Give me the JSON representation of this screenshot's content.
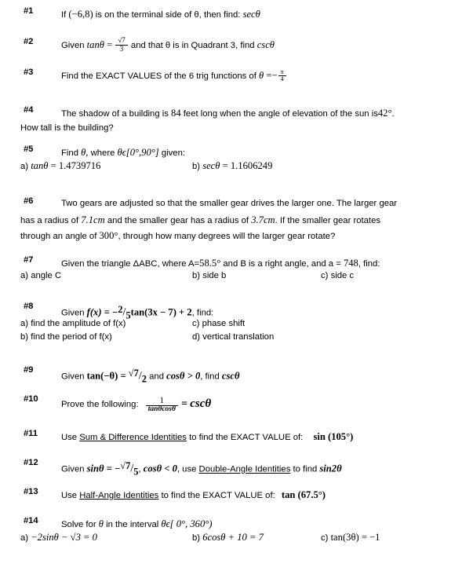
{
  "document": {
    "type": "trigonometry-worksheet",
    "background_color": "#ffffff",
    "text_color": "#000000"
  },
  "problems": [
    {
      "number": "#1",
      "lead": "If",
      "point": "(−6,8)",
      "mid": "is on the terminal side of θ, then find:",
      "answer_fn": "secθ"
    },
    {
      "number": "#2",
      "lead": "Given",
      "fn": "tanθ",
      "eq": "=",
      "frac_num": "√7",
      "frac_den": "3",
      "mid": "and that θ is in Quadrant 3, find",
      "answer_fn": "cscθ"
    },
    {
      "number": "#3",
      "lead": "Find the EXACT VALUES of the 6 trig functions of",
      "var": "θ",
      "eq": "=",
      "sign": "−",
      "frac_num": "π",
      "frac_den": "4"
    },
    {
      "number": "#4",
      "line1_a": "The shadow of a building is",
      "shadow_length": "84",
      "line1_b": "feet long when the angle of elevation of the sun is",
      "angle": "42°",
      "line1_c": ".",
      "line2": "How tall is the building?"
    },
    {
      "number": "#5",
      "lead": "Find",
      "var": "θ,",
      "where": "where",
      "interval": "θϵ[0°,90°]",
      "tail": "given:",
      "parts": [
        {
          "label": "a)",
          "fn": "tanθ",
          "eq": "=",
          "value": "1.4739716"
        },
        {
          "label": "b)",
          "fn": "secθ",
          "eq": "=",
          "value": "1.1606249"
        }
      ]
    },
    {
      "number": "#6",
      "line1_a": "Two gears are adjusted so that the smaller gear drives the larger one.  The larger gear",
      "line2_a": "has a radius of",
      "large_radius": "7.1cm",
      "line2_b": "and the smaller gear has a radius of",
      "small_radius": "3.7cm",
      "line2_c": ".  If the smaller gear rotates",
      "line3_a": "through an angle of",
      "rotation": "300°",
      "line3_b": ", through how many degrees will the larger gear rotate?"
    },
    {
      "number": "#7",
      "lead": "Given the triangle ΔABC, where A=",
      "angle_a": "58.5°",
      "mid": "and B is a right angle, and  a =",
      "side_a": "748",
      "tail": ", find:",
      "parts": [
        {
          "label": "a)",
          "text": "angle C"
        },
        {
          "label": "b)",
          "text": "side b"
        },
        {
          "label": "c)",
          "text": "side c"
        }
      ]
    },
    {
      "number": "#8",
      "lead": "Given",
      "fn": "f(x)",
      "eq": "=",
      "sign": "−",
      "coef_num": "2",
      "coef_den": "5",
      "expr": "tan(3x − 7)",
      "plus": "+",
      "constant": "2",
      "tail": ", find:",
      "parts": [
        {
          "label": "a)",
          "text": "find the amplitude of f(x)"
        },
        {
          "label": "b)",
          "text": "find the period of f(x)"
        },
        {
          "label": "c)",
          "text": "phase shift"
        },
        {
          "label": "d)",
          "text": "vertical translation"
        }
      ]
    },
    {
      "number": "#9",
      "lead": "Given",
      "fn": "tan(−θ)",
      "eq": "=",
      "frac_num": "√7",
      "frac_den": "2",
      "mid": "and",
      "cond": "cosθ > 0",
      "tail": ", find",
      "answer_fn": "cscθ"
    },
    {
      "number": "#10",
      "lead": "Prove the following:",
      "frac_num": "1",
      "frac_den": "tanθcosθ",
      "eq": "=",
      "rhs": "cscθ"
    },
    {
      "number": "#11",
      "lead": "Use",
      "identity": "Sum & Difference Identities",
      "mid": "to find the EXACT VALUE of:",
      "expr": "sin (105°)"
    },
    {
      "number": "#12",
      "lead": "Given",
      "fn": "sinθ",
      "eq": "=",
      "sign": "−",
      "frac_num": "√7",
      "frac_den": "5",
      "comma": ",",
      "cond": "cosθ < 0",
      "mid": ", use",
      "identity": "Double-Angle Identities",
      "tail": "to find",
      "answer_fn": "sin2θ"
    },
    {
      "number": "#13",
      "lead": "Use",
      "identity": "Half-Angle Identities",
      "mid": "to find the EXACT VALUE of:",
      "expr": "tan (67.5°)"
    },
    {
      "number": "#14",
      "lead": "Solve for",
      "var": "θ",
      "mid": "in the interval",
      "interval": "θϵ[ 0°, 360°)",
      "parts": [
        {
          "label": "a)",
          "text": "−2sinθ − √3 = 0"
        },
        {
          "label": "b)",
          "text": "6cosθ + 10 = 7"
        },
        {
          "label": "c)",
          "text": "tan(3θ) = −1"
        }
      ]
    }
  ]
}
